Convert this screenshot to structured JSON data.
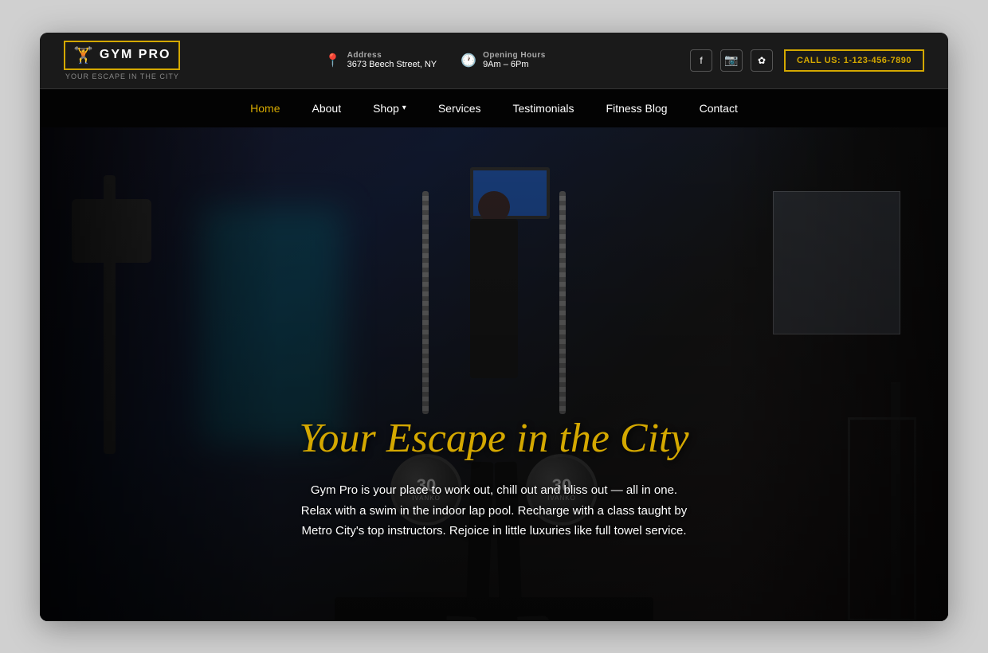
{
  "browser": {
    "shadow": true
  },
  "topbar": {
    "logo": {
      "name": "GYM PRO",
      "tagline": "YOUR ESCAPE IN THE CITY",
      "icon": "🏋"
    },
    "address": {
      "label": "Address",
      "value": "3673 Beech Street, NY",
      "icon": "📍"
    },
    "hours": {
      "label": "Opening Hours",
      "value": "9Am – 6Pm",
      "icon": "🕐"
    },
    "social": {
      "facebook": "f",
      "instagram": "📷",
      "yelp": "✿"
    },
    "call_button": "CALL US: 1-123-456-7890"
  },
  "nav": {
    "items": [
      {
        "label": "Home",
        "active": true,
        "has_dropdown": false
      },
      {
        "label": "About",
        "active": false,
        "has_dropdown": false
      },
      {
        "label": "Shop",
        "active": false,
        "has_dropdown": true
      },
      {
        "label": "Services",
        "active": false,
        "has_dropdown": false
      },
      {
        "label": "Testimonials",
        "active": false,
        "has_dropdown": false
      },
      {
        "label": "Fitness Blog",
        "active": false,
        "has_dropdown": false
      },
      {
        "label": "Contact",
        "active": false,
        "has_dropdown": false
      }
    ]
  },
  "hero": {
    "title": "Your Escape in the City",
    "description": "Gym Pro is your place to work out, chill out and bliss out — all in one. Relax with a swim in the indoor lap pool. Recharge with a class taught by Metro City's top instructors. Rejoice in little luxuries like full towel service.",
    "weight_left": "30",
    "weight_right": "30",
    "brand": "IVANKO"
  }
}
